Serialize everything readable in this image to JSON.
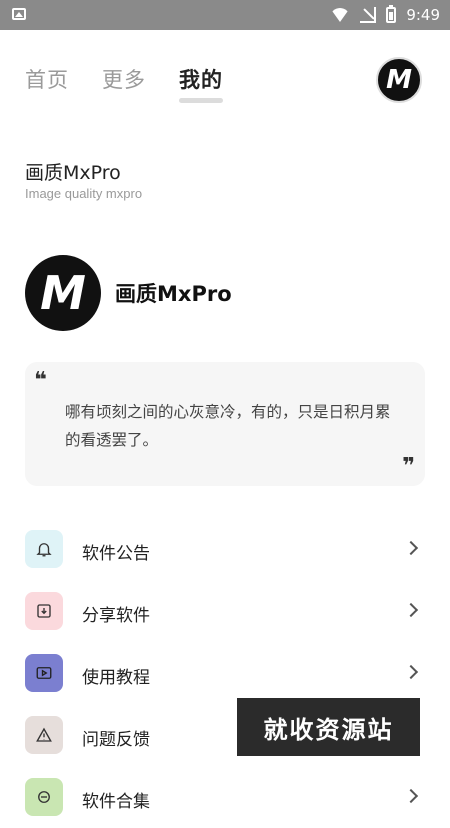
{
  "status_bar": {
    "time": "9:49",
    "icons": [
      "image-icon",
      "wifi-icon",
      "no-signal-icon",
      "battery-charging-icon"
    ]
  },
  "tabs": [
    {
      "label": "首页",
      "active": false
    },
    {
      "label": "更多",
      "active": false
    },
    {
      "label": "我的",
      "active": true
    }
  ],
  "logo_letter": "M",
  "app": {
    "title": "画质MxPro",
    "subtitle": "Image quality mxpro"
  },
  "profile": {
    "name": "画质MxPro"
  },
  "quote": {
    "open_mark": "❝",
    "close_mark": "❞",
    "text": "哪有顷刻之间的心灰意冷，有的，只是日积月累的看透罢了。"
  },
  "menu": [
    {
      "label": "软件公告",
      "icon": "bell-icon",
      "bg": "#dff3f7"
    },
    {
      "label": "分享软件",
      "icon": "download-box-icon",
      "bg": "#fbd9dd"
    },
    {
      "label": "使用教程",
      "icon": "play-icon",
      "bg": "#7b7fd0"
    },
    {
      "label": "问题反馈",
      "icon": "warning-icon",
      "bg": "#e6dedb"
    },
    {
      "label": "软件合集",
      "icon": "collection-icon",
      "bg": "#c9e6b2"
    }
  ],
  "watermark": "就收资源站"
}
